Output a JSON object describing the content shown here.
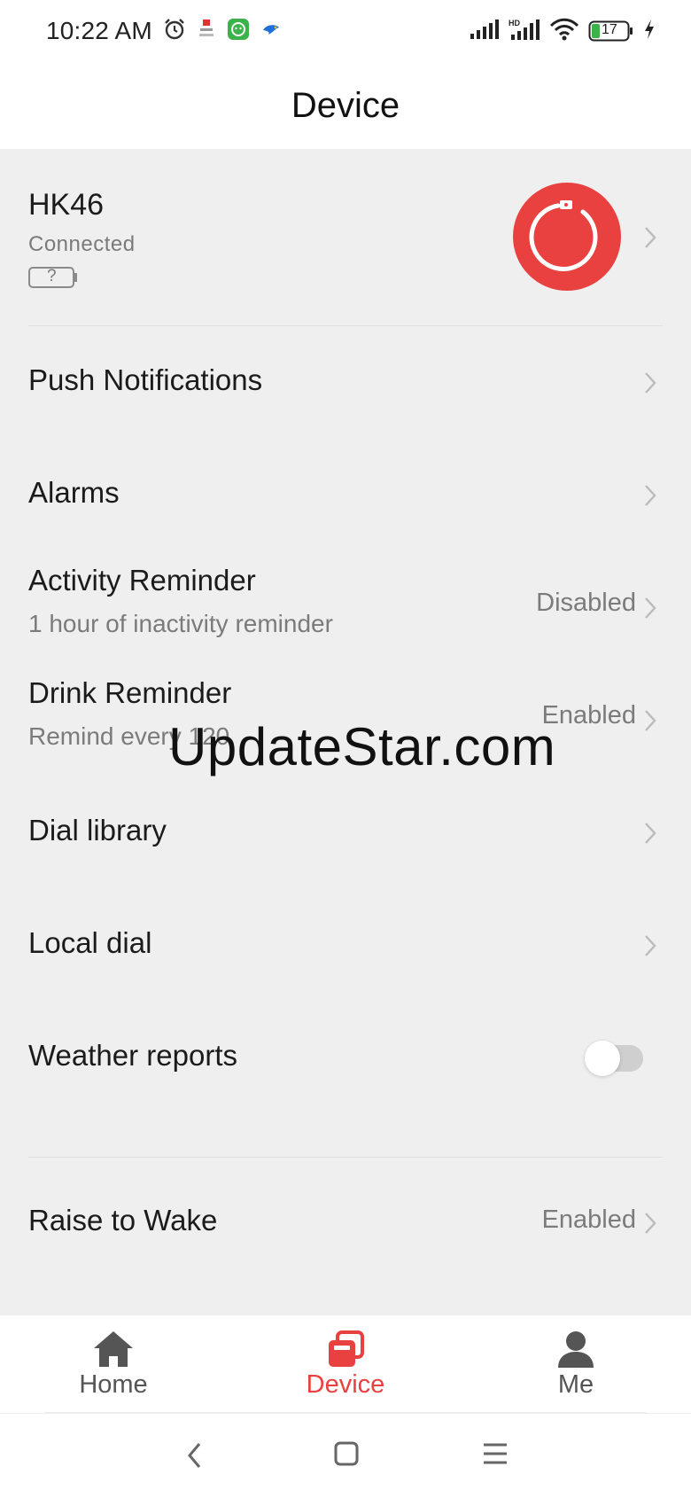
{
  "status_bar": {
    "time": "10:22 AM",
    "battery_level": "17",
    "icons": [
      "alarm-icon",
      "app-notification-icon",
      "wechat-icon",
      "bird-app-icon",
      "signal-icon",
      "hd-signal-icon",
      "wifi-icon",
      "battery-icon",
      "charging-icon"
    ]
  },
  "header": {
    "title": "Device"
  },
  "device": {
    "name": "HK46",
    "status": "Connected",
    "battery_text": "?",
    "avatar_color": "#e8413f"
  },
  "settings": [
    {
      "title": "Push Notifications"
    },
    {
      "title": "Alarms"
    },
    {
      "title": "Activity Reminder",
      "subtitle": "1 hour of inactivity reminder",
      "value": "Disabled"
    },
    {
      "title": "Drink Reminder",
      "subtitle": "Remind every 120",
      "value": "Enabled"
    },
    {
      "title": "Dial library"
    },
    {
      "title": "Local dial"
    },
    {
      "title": "Weather reports",
      "toggle": "off"
    },
    {
      "title": "Raise to Wake",
      "value": "Enabled"
    }
  ],
  "watermark": "UpdateStar.com",
  "bottom_nav": {
    "items": [
      {
        "label": "Home",
        "icon": "home-icon"
      },
      {
        "label": "Device",
        "icon": "device-icon",
        "active": true
      },
      {
        "label": "Me",
        "icon": "person-icon"
      }
    ],
    "active_color": "#e8413f"
  },
  "system_nav": {
    "buttons": [
      "back-icon",
      "home-square-icon",
      "menu-icon"
    ]
  }
}
